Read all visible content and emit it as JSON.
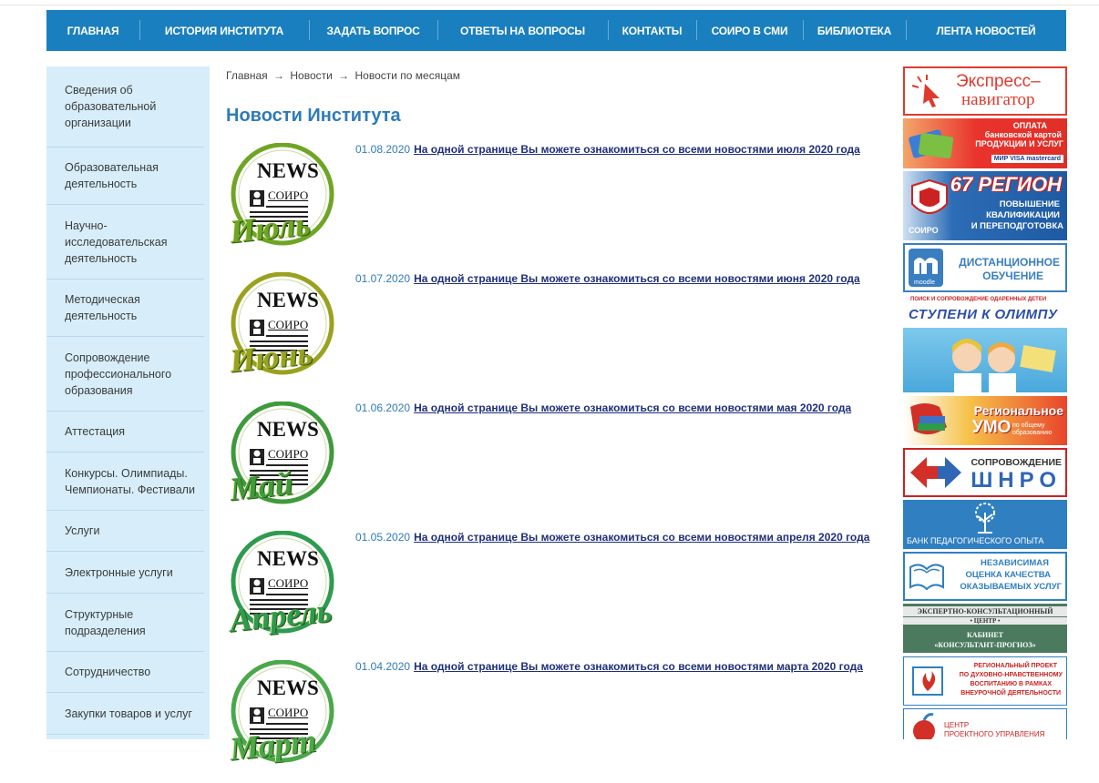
{
  "nav": {
    "items": [
      {
        "label": "ГЛАВНАЯ"
      },
      {
        "label": "ИСТОРИЯ ИНСТИТУТА"
      },
      {
        "label": "ЗАДАТЬ ВОПРОС"
      },
      {
        "label": "ОТВЕТЫ НА ВОПРОСЫ"
      },
      {
        "label": "КОНТАКТЫ"
      },
      {
        "label": "СОИРО В СМИ"
      },
      {
        "label": "БИБЛИОТЕКА"
      },
      {
        "label": "ЛЕНТА НОВОСТЕЙ"
      }
    ]
  },
  "sidebar": {
    "items": [
      {
        "label": "Сведения об образовательной организации"
      },
      {
        "label": "Образовательная деятельность"
      },
      {
        "label": "Научно-исследовательская деятельность"
      },
      {
        "label": "Методическая деятельность"
      },
      {
        "label": "Сопровождение профессионального образования"
      },
      {
        "label": "Аттестация"
      },
      {
        "label": "Конкурсы. Олимпиады. Чемпионаты. Фестивали"
      },
      {
        "label": "Услуги"
      },
      {
        "label": "Электронные услуги"
      },
      {
        "label": "Структурные подразделения"
      },
      {
        "label": "Сотрудничество"
      },
      {
        "label": "Закупки товаров и услуг"
      }
    ]
  },
  "breadcrumb": {
    "home": "Главная",
    "news": "Новости",
    "current": "Новости по месяцам",
    "separator": "→"
  },
  "page_title": "Новости Института",
  "news_logo": {
    "news": "NEWS",
    "brand": "СОИРО"
  },
  "news": [
    {
      "date": "01.08.2020",
      "link": "На одной странице Вы можете ознакомиться со всеми новостями июля 2020 года",
      "month_script": "Июль"
    },
    {
      "date": "01.07.2020",
      "link": "На одной странице Вы можете ознакомиться со всеми новостями июня 2020 года",
      "month_script": "Июнь"
    },
    {
      "date": "01.06.2020",
      "link": "На одной странице Вы можете ознакомиться со всеми новостями мая 2020 года",
      "month_script": "Май"
    },
    {
      "date": "01.05.2020",
      "link": "На одной странице Вы можете ознакомиться со всеми новостями апреля 2020 года",
      "month_script": "Апрель"
    },
    {
      "date": "01.04.2020",
      "link": "На одной странице Вы можете ознакомиться со всеми новостями марта 2020 года",
      "month_script": "Март"
    }
  ],
  "banners": {
    "express": {
      "line1": "Экспресс–",
      "line2": "навигатор"
    },
    "payment": {
      "line1": "ОПЛАТА",
      "line2": "банковской картой",
      "line3": "ПРОДУКЦИИ И УСЛУГ",
      "cards": "МИР VISA mastercard"
    },
    "region": {
      "title": "67 РЕГИОН",
      "line1": "ПОВЫШЕНИЕ",
      "line2": "КВАЛИФИКАЦИИ",
      "line3": "И ПЕРЕПОДГОТОВКА",
      "brand": "СОИРО"
    },
    "distance": {
      "line1": "ДИСТАНЦИОННОЕ",
      "line2": "ОБУЧЕНИЕ",
      "brand": "moodle"
    },
    "olymp": {
      "top": "поиск и сопровождение одаренных детей",
      "title": "СТУПЕНИ К ОЛИМПУ"
    },
    "umo": {
      "line1": "Региональное",
      "line2": "УМО",
      "line3": "по общему образованию"
    },
    "shnro": {
      "line1": "СОПРОВОЖДЕНИЕ",
      "line2": "ШНРО"
    },
    "bank": {
      "label": "БАНК ПЕДАГОГИЧЕСКОГО ОПЫТА"
    },
    "quality": {
      "line1": "НЕЗАВИСИМАЯ",
      "line2": "ОЦЕНКА КАЧЕСТВА",
      "line3": "ОКАЗЫВАЕМЫХ УСЛУГ"
    },
    "expert": {
      "line1": "ЭКСПЕРТНО-КОНСУЛЬТАЦИОННЫЙ",
      "line2": "• ЦЕНТР •",
      "line3": "КАБИНЕТ",
      "line4": "«КОНСУЛЬТАНТ-ПРОГНОЗ»"
    },
    "project": {
      "line1": "РЕГИОНАЛЬНЫЙ ПРОЕКТ",
      "line2": "ПО ДУХОВНО-НРАВСТВЕННОМУ",
      "line3": "ВОСПИТАНИЮ В РАМКАХ",
      "line4": "ВНЕУРОЧНОЙ ДЕЯТЕЛЬНОСТИ"
    },
    "center": {
      "line1": "ЦЕНТР",
      "line2": "ПРОЕКТНОГО УПРАВЛЕНИЯ"
    }
  },
  "colors": {
    "nav_bg": "#1a7fbf",
    "sidebar_bg": "#d7eefa",
    "title": "#2e7bb8",
    "link": "#1f2f7a"
  }
}
